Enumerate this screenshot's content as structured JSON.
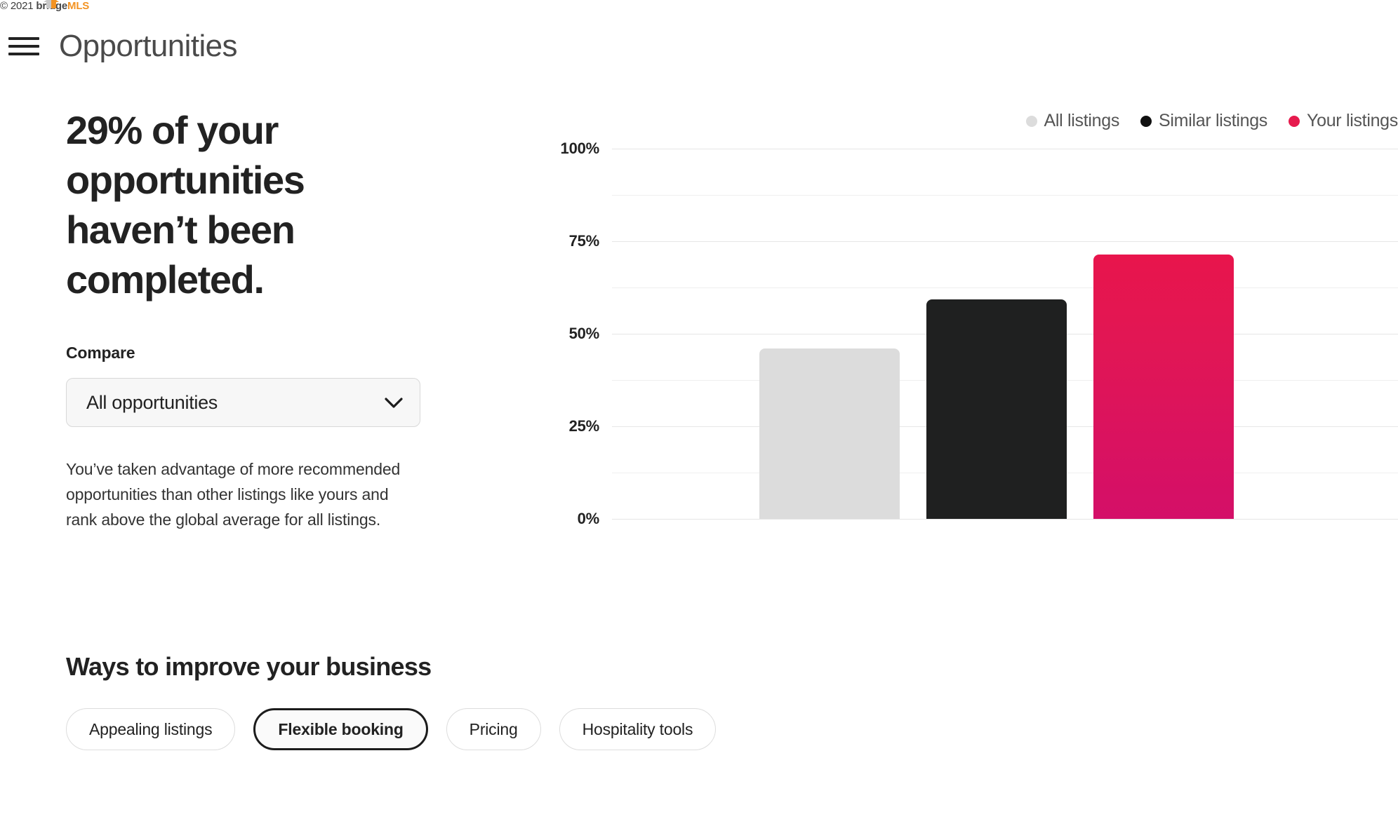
{
  "watermark": {
    "copyright": "© 2021",
    "brand_prefix": "bridge",
    "brand_suffix": "MLS",
    "brand_color": "#F39323"
  },
  "topbar": {
    "menu_icon": "hamburger-menu-icon",
    "title": "Opportunities"
  },
  "left_panel": {
    "headline": "29% of your opportunities haven’t been completed.",
    "compare_label": "Compare",
    "compare_selected": "All opportunities",
    "compare_chevron_icon": "chevron-down-icon",
    "body_copy": "You’ve taken advantage of more recommended opportunities than other listings like yours and rank above the global average for all listings."
  },
  "chart_data": {
    "type": "bar",
    "title": "",
    "xlabel": "",
    "ylabel": "",
    "ylim": [
      0,
      100
    ],
    "grid": true,
    "legend_position": "top-right",
    "categories": [
      "All listings",
      "Similar listings",
      "Your listings"
    ],
    "values": [
      46,
      59,
      71
    ],
    "tick_labels": [
      "100%",
      "75%",
      "50%",
      "25%",
      "0%"
    ],
    "tick_values": [
      100,
      75,
      50,
      25,
      0
    ],
    "minor_tick_values": [
      87.5,
      62.5,
      37.5,
      12.5
    ],
    "series": [
      {
        "name": "All listings",
        "value": 46,
        "color": "#dcdcdc"
      },
      {
        "name": "Similar listings",
        "value": 59,
        "color": "#1f2020"
      },
      {
        "name": "Your listings",
        "value": 71,
        "color": "#E61A4D",
        "color_bottom": "#CE0E6B"
      }
    ],
    "legend": [
      {
        "label": "All listings",
        "color": "#dcdcdc"
      },
      {
        "label": "Similar listings",
        "color": "#111111"
      },
      {
        "label": "Your listings",
        "color": "#E61A4D"
      }
    ]
  },
  "improve_section": {
    "title": "Ways to improve your business",
    "pills": [
      {
        "label": "Appealing listings",
        "selected": false
      },
      {
        "label": "Flexible booking",
        "selected": true
      },
      {
        "label": "Pricing",
        "selected": false
      },
      {
        "label": "Hospitality tools",
        "selected": false
      }
    ]
  }
}
